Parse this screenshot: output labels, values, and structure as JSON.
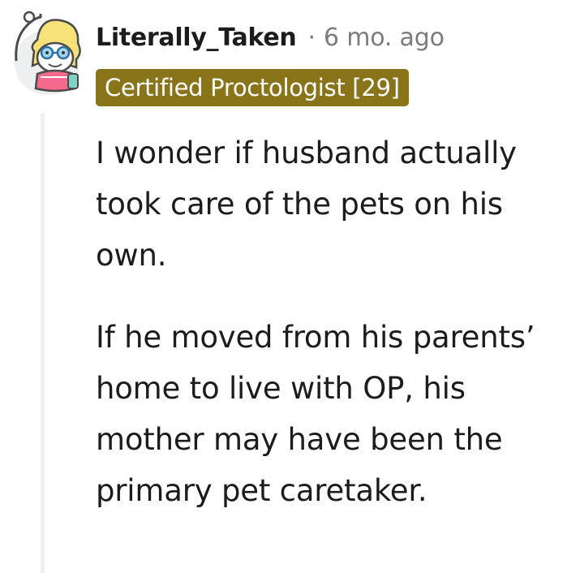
{
  "comment": {
    "author": "Literally_Taken",
    "separator": "·",
    "timestamp": "6 mo. ago",
    "flair": "Certified Proctologist [29]",
    "paragraphs": [
      "I wonder if husband actually took care of the pets on his own.",
      "If he moved from his parents’ home to live with OP, his mother may have been the primary pet caretaker."
    ]
  },
  "colors": {
    "flair_background": "#8a7419",
    "flair_text": "#ffffff",
    "meta_text": "#7c7c7c",
    "thread_line": "#edeff1"
  },
  "icons": {
    "avatar": "snoo-avatar-blonde-glasses"
  }
}
